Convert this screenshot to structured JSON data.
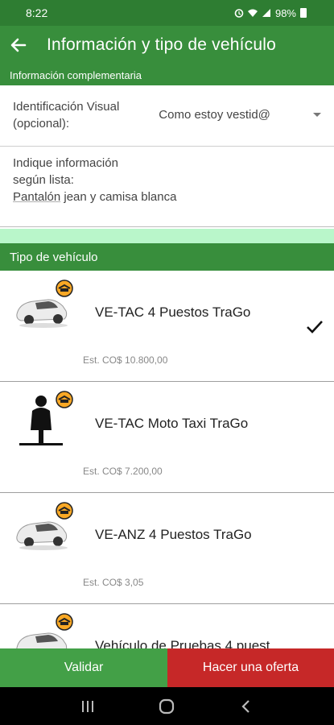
{
  "status_bar": {
    "time": "8:22",
    "battery": "98%"
  },
  "app_bar": {
    "title": "Información y tipo de vehículo"
  },
  "section_info": {
    "label": "Información complementaria"
  },
  "visual_id": {
    "label": "Identificación Visual (opcional):",
    "selected": "Como estoy vestid@"
  },
  "info_field": {
    "label": "Indique información según lista:",
    "value_first_word": "Pantalón",
    "value_rest": " jean y camisa blanca"
  },
  "section_vehicle": {
    "label": "Tipo de vehículo"
  },
  "vehicles": [
    {
      "name": "VE-TAC 4 Puestos TraGo",
      "price": "Est. CO$ 10.800,00",
      "selected": true,
      "icon": "car-icon"
    },
    {
      "name": "VE-TAC Moto Taxi TraGo",
      "price": "Est. CO$ 7.200,00",
      "selected": false,
      "icon": "motorcycle-icon"
    },
    {
      "name": "VE-ANZ 4 Puestos TraGo",
      "price": "Est. CO$ 3,05",
      "selected": false,
      "icon": "car-icon"
    },
    {
      "name": "Vehículo de Pruebas 4 puest",
      "price": "",
      "selected": false,
      "icon": "car-icon"
    }
  ],
  "bottom_bar": {
    "validar": "Validar",
    "oferta": "Hacer una oferta"
  },
  "colors": {
    "primary": "#388e3c",
    "status": "#2e7d32",
    "accent_mint": "#b9f6ca",
    "offer_red": "#c62828",
    "validate_green": "#43a047"
  }
}
